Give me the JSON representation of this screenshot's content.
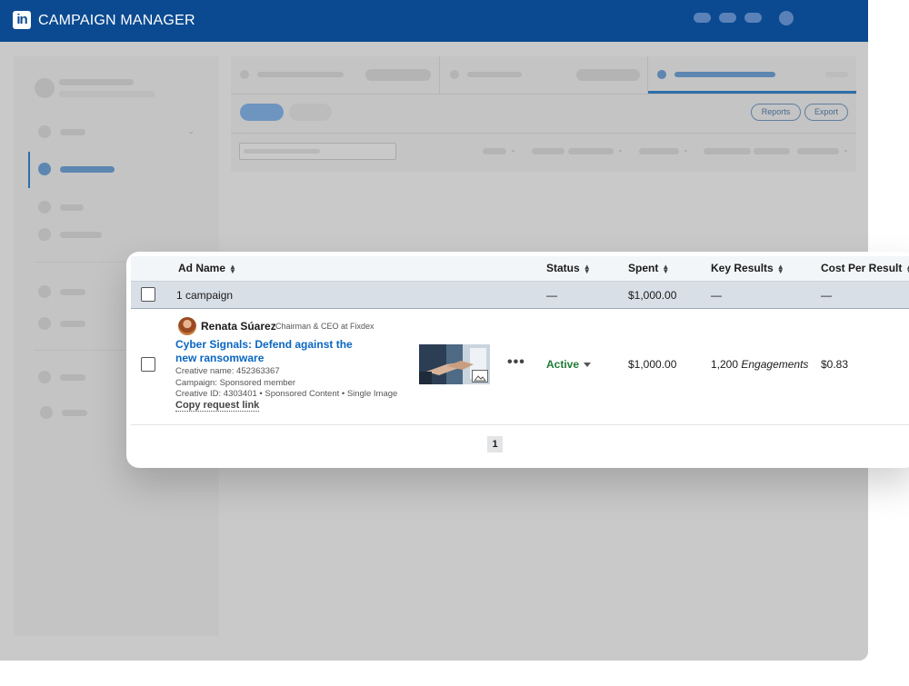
{
  "topbar": {
    "app_title": "CAMPAIGN MANAGER",
    "logo_text": "in",
    "brand_color": "#0b4a91"
  },
  "toolbar": {
    "reports_label": "Reports",
    "export_label": "Export"
  },
  "table": {
    "headers": {
      "ad_name": "Ad Name",
      "status": "Status",
      "spent": "Spent",
      "key_results": "Key Results",
      "cost_per_result": "Cost Per Result"
    },
    "summary": {
      "label": "1 campaign",
      "status": "—",
      "spent": "$1,000.00",
      "key_results": "—",
      "cost_per_result": "—"
    },
    "rows": [
      {
        "member_name": "Renata Súarez",
        "member_title": "Chairman & CEO at Fixdex",
        "ad_title": "Cyber Signals: Defend against the new ransomware",
        "creative_name": "Creative name: 452363367",
        "campaign": "Campaign: Sponsored member",
        "creative_id": "Creative ID: 4303401 • Sponsored Content • Single Image",
        "copy_link": "Copy request link",
        "status": "Active",
        "spent": "$1,000.00",
        "key_results_count": "1,200",
        "key_results_unit": "Engagements",
        "cost_per_result": "$0.83"
      }
    ]
  },
  "pagination": {
    "current_page": "1"
  },
  "icons": {
    "sort": "sort-icon",
    "more": "more-options-icon",
    "image": "image-icon",
    "dropdown": "dropdown-caret-icon"
  }
}
